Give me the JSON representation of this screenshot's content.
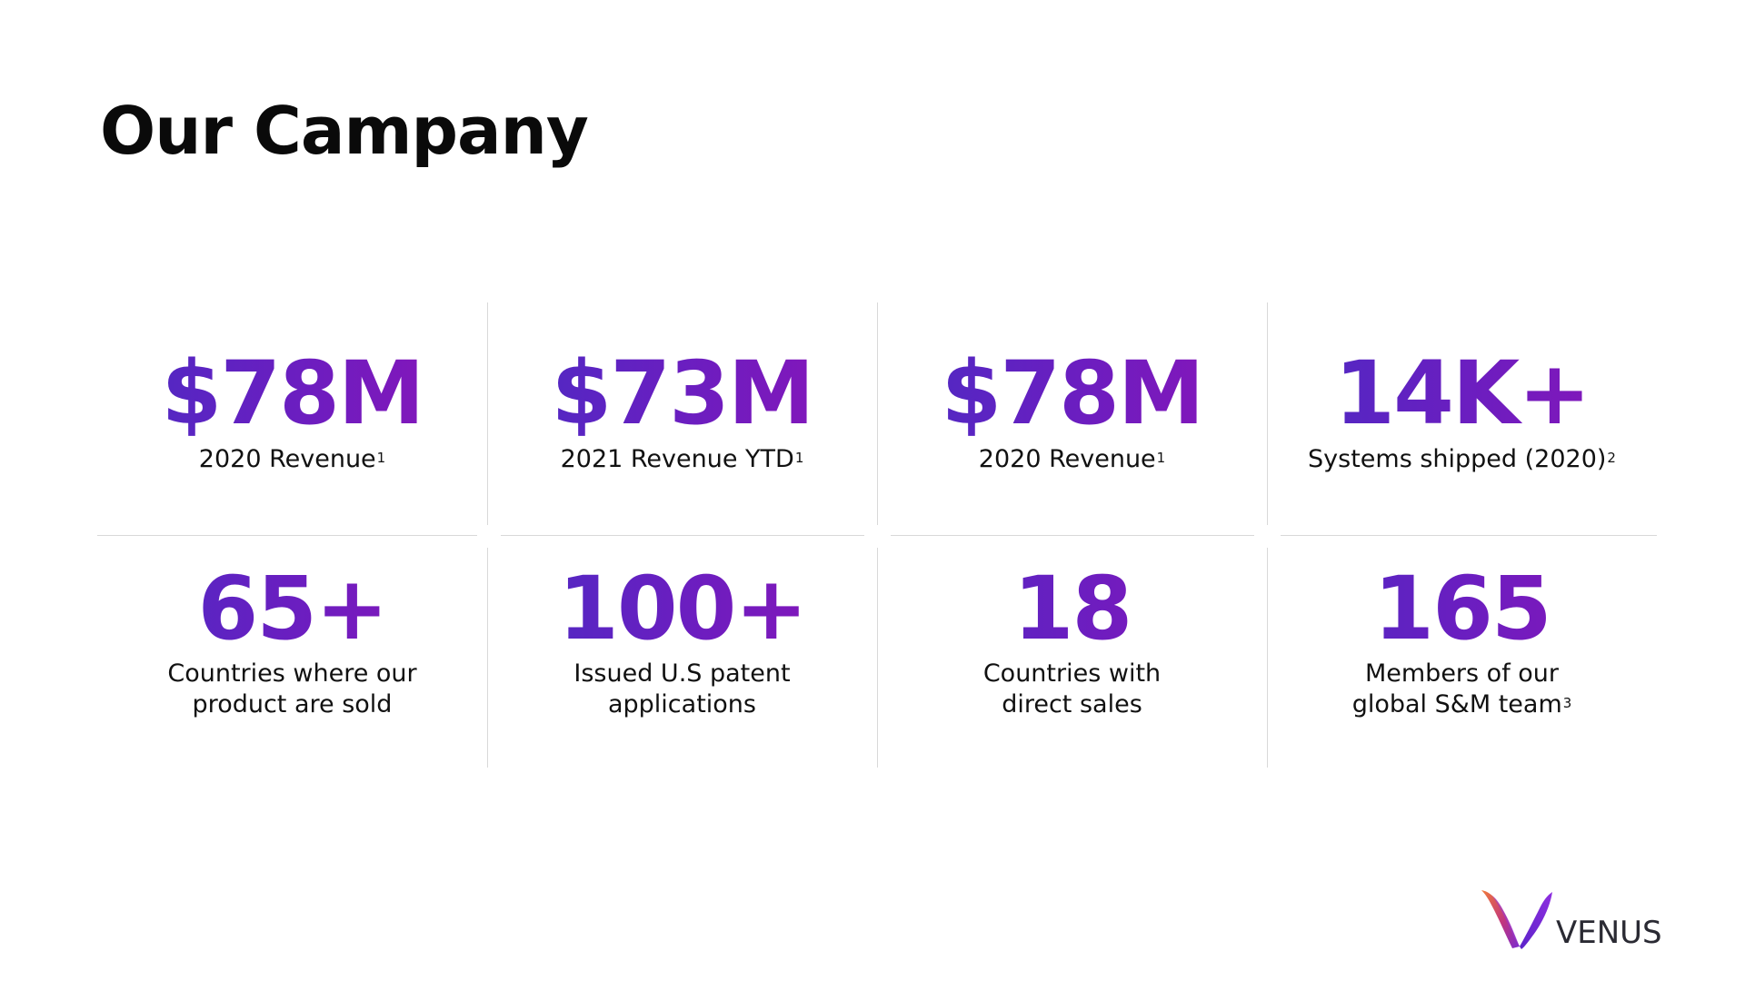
{
  "slide": {
    "title": "Our Campany"
  },
  "stats": [
    {
      "value": "$78M",
      "label_lines": [
        "2020 Revenue"
      ],
      "footnote": "1"
    },
    {
      "value": "$73M",
      "label_lines": [
        "2021 Revenue YTD"
      ],
      "footnote": "1"
    },
    {
      "value": "$78M",
      "label_lines": [
        "2020 Revenue"
      ],
      "footnote": "1"
    },
    {
      "value": "14K+",
      "label_lines": [
        "Systems shipped (2020)"
      ],
      "footnote": "2"
    },
    {
      "value": "65+",
      "label_lines": [
        "Countries where our",
        "product are sold"
      ],
      "footnote": ""
    },
    {
      "value": "100+",
      "label_lines": [
        "Issued U.S patent",
        "applications"
      ],
      "footnote": ""
    },
    {
      "value": "18",
      "label_lines": [
        "Countries with",
        "direct sales"
      ],
      "footnote": ""
    },
    {
      "value": "165",
      "label_lines": [
        "Members of our",
        "global S&M team"
      ],
      "footnote": "3"
    }
  ],
  "logo": {
    "text": "VENUS",
    "icon": "venus-v-logo-icon"
  },
  "colors": {
    "accent_start": "#4a2bc4",
    "accent_end": "#8b14b8",
    "divider": "#d9d9d9",
    "title": "#0a0a0a"
  }
}
